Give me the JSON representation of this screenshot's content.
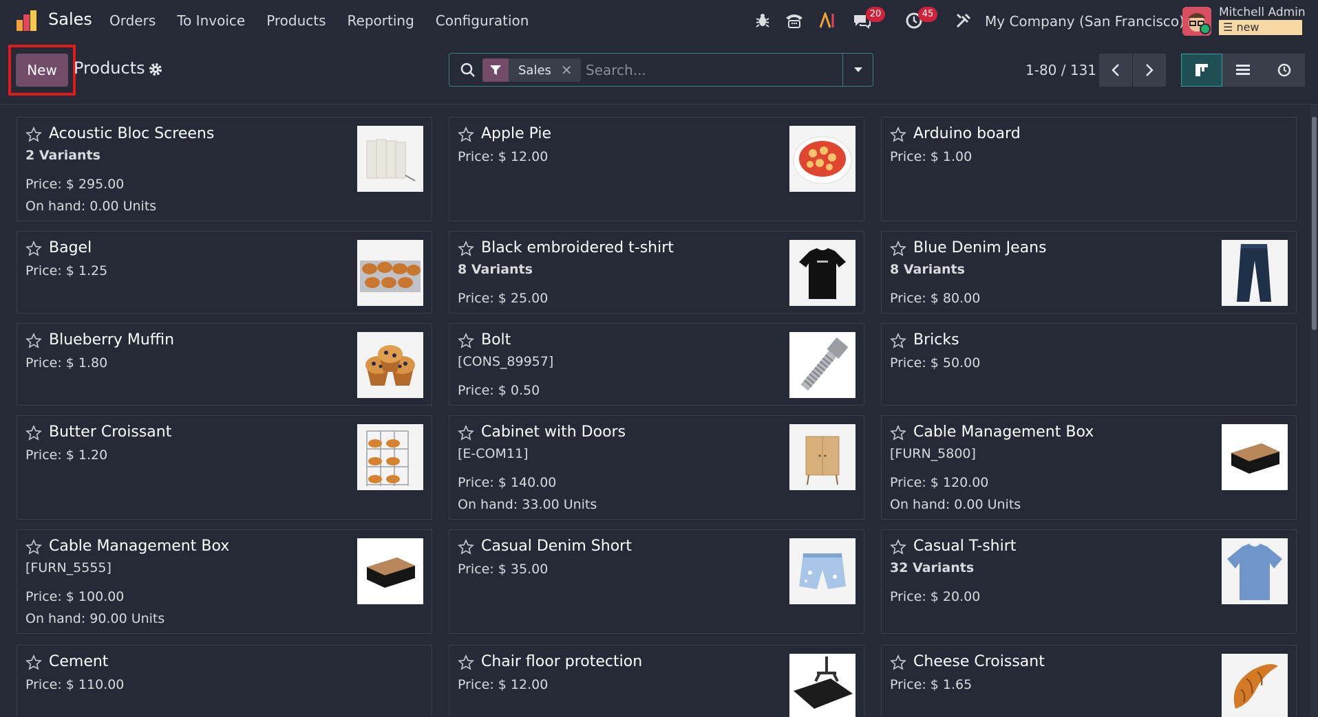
{
  "navbar": {
    "app_name": "Sales",
    "menu": [
      "Orders",
      "To Invoice",
      "Products",
      "Reporting",
      "Configuration"
    ],
    "discuss_badge": "20",
    "activity_badge": "45",
    "company": "My Company (San Francisco)",
    "user_name": "Mitchell Admin",
    "database": "new"
  },
  "control_panel": {
    "new_label": "New",
    "title": "Products",
    "facet_label": "Sales",
    "search_placeholder": "Search...",
    "pager": "1-80 / 131"
  },
  "colors": {
    "background": "#262a36",
    "brand": "#714b67",
    "highlight": "#e01b1b",
    "badge": "#d0233b"
  },
  "products": [
    {
      "name": "Acoustic Bloc Screens",
      "lines": [
        {
          "text": "2 Variants",
          "bold": true
        },
        {
          "text": "Price: $ 295.00"
        },
        {
          "text": "On hand: 0.00 Units"
        }
      ],
      "thumb": "screens"
    },
    {
      "name": "Apple Pie",
      "lines": [
        {
          "text": "Price: $ 12.00"
        }
      ],
      "thumb": "pie"
    },
    {
      "name": "Arduino board",
      "lines": [
        {
          "text": "Price: $ 1.00"
        }
      ],
      "thumb": ""
    },
    {
      "name": "Bagel",
      "lines": [
        {
          "text": "Price: $ 1.25"
        }
      ],
      "thumb": "bagel"
    },
    {
      "name": "Black embroidered t-shirt",
      "lines": [
        {
          "text": "8 Variants",
          "bold": true
        },
        {
          "text": "Price: $ 25.00"
        }
      ],
      "thumb": "black-tshirt"
    },
    {
      "name": "Blue Denim Jeans",
      "lines": [
        {
          "text": "8 Variants",
          "bold": true
        },
        {
          "text": "Price: $ 80.00"
        }
      ],
      "thumb": "jeans"
    },
    {
      "name": "Blueberry Muffin",
      "lines": [
        {
          "text": "Price: $ 1.80"
        }
      ],
      "thumb": "muffin"
    },
    {
      "name": "Bolt",
      "lines": [
        {
          "text": "[CONS_89957]"
        },
        {
          "text": "Price: $ 0.50"
        }
      ],
      "thumb": "bolt"
    },
    {
      "name": "Bricks",
      "lines": [
        {
          "text": "Price: $ 50.00"
        }
      ],
      "thumb": ""
    },
    {
      "name": "Butter Croissant",
      "lines": [
        {
          "text": "Price: $ 1.20"
        }
      ],
      "thumb": "croissant-rack"
    },
    {
      "name": "Cabinet with Doors",
      "lines": [
        {
          "text": "[E-COM11]"
        },
        {
          "text": "Price: $ 140.00"
        },
        {
          "text": "On hand: 33.00 Units"
        }
      ],
      "thumb": "cabinet"
    },
    {
      "name": "Cable Management Box",
      "lines": [
        {
          "text": "[FURN_5800]"
        },
        {
          "text": "Price: $ 120.00"
        },
        {
          "text": "On hand: 0.00 Units"
        }
      ],
      "thumb": "cable-box"
    },
    {
      "name": "Cable Management Box",
      "lines": [
        {
          "text": "[FURN_5555]"
        },
        {
          "text": "Price: $ 100.00"
        },
        {
          "text": "On hand: 90.00 Units"
        }
      ],
      "thumb": "cable-box"
    },
    {
      "name": "Casual Denim Short",
      "lines": [
        {
          "text": "Price: $ 35.00"
        }
      ],
      "thumb": "shorts"
    },
    {
      "name": "Casual T-shirt",
      "lines": [
        {
          "text": "32 Variants",
          "bold": true
        },
        {
          "text": "Price: $ 20.00"
        }
      ],
      "thumb": "blue-tshirt"
    },
    {
      "name": "Cement",
      "lines": [
        {
          "text": "Price: $ 110.00"
        }
      ],
      "thumb": ""
    },
    {
      "name": "Chair floor protection",
      "lines": [
        {
          "text": "Price: $ 12.00"
        }
      ],
      "thumb": "floor-mat"
    },
    {
      "name": "Cheese Croissant",
      "lines": [
        {
          "text": "Price: $ 1.65"
        }
      ],
      "thumb": "croissant"
    }
  ]
}
